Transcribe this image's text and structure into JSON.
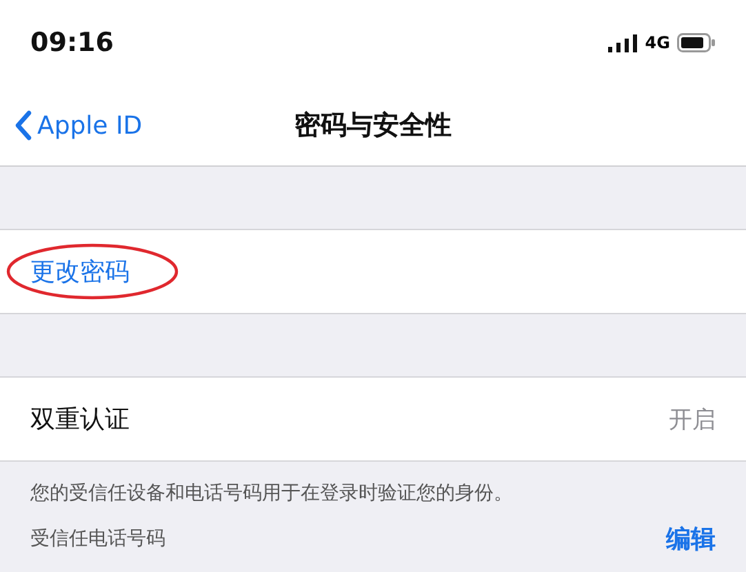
{
  "status_bar": {
    "time": "09:16",
    "network": "4G"
  },
  "nav_bar": {
    "back": "Apple ID",
    "title": "密码与安全性"
  },
  "change_password": {
    "label": "更改密码",
    "highlighted": true
  },
  "two_factor": {
    "label": "双重认证",
    "value": "开启"
  },
  "footer": {
    "note": "您的受信任设备和电话号码用于在登录时验证您的身份。",
    "label": "受信任电话号码",
    "action": "编辑"
  }
}
